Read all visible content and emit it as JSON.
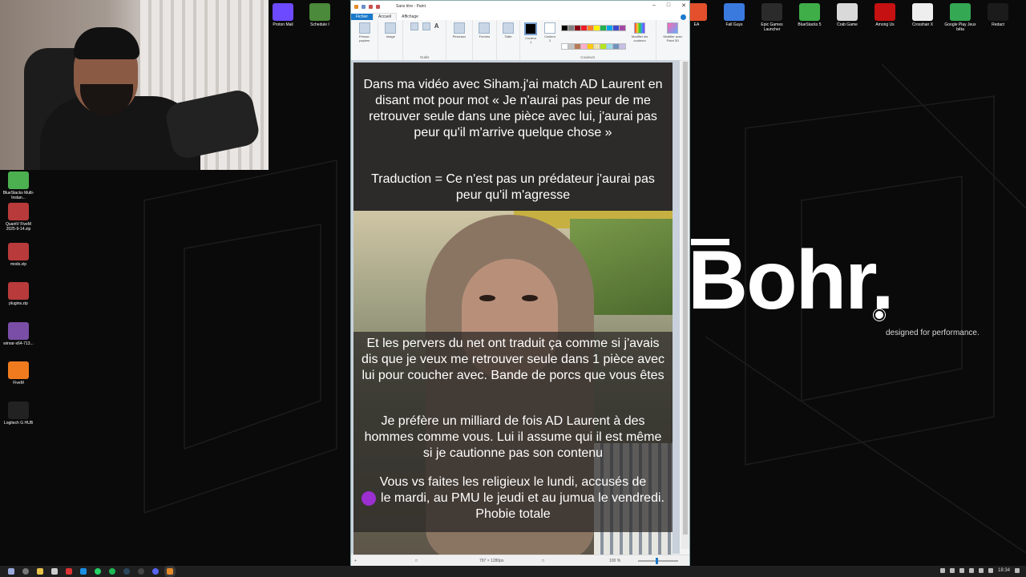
{
  "desktop": {
    "left_icons": [
      {
        "label": "BlueStacks Multi-Instan...",
        "color": "#4caf50"
      },
      {
        "label": "QuantV FiveM 2025-9-14.zip",
        "color": "#b83a3a"
      },
      {
        "label": "mods.zip",
        "color": "#b83a3a"
      },
      {
        "label": "plugins.zip",
        "color": "#b83a3a"
      },
      {
        "label": "winrar-x64-713...",
        "color": "#7a4ea6"
      },
      {
        "label": "FiveM",
        "color": "#f07b1e"
      },
      {
        "label": "Logitech G HUB",
        "color": "#222222"
      }
    ],
    "top_icons_left": [
      {
        "label": "Proton Mail",
        "color": "#6d4aff"
      },
      {
        "label": "Schedule I",
        "color": "#4a8a3a"
      }
    ],
    "top_icons_right": [
      {
        "label": "EA",
        "color": "#e4502c"
      },
      {
        "label": "Fall Guys",
        "color": "#3a7adf"
      },
      {
        "label": "Epic Games Launcher",
        "color": "#2b2b2b"
      },
      {
        "label": "BlueStacks 5",
        "color": "#3fae49"
      },
      {
        "label": "Crab Game",
        "color": "#d9d9d9"
      },
      {
        "label": "Among Us",
        "color": "#c51111"
      },
      {
        "label": "Crosshair X",
        "color": "#eeeeee"
      },
      {
        "label": "Google Play Jeux bêta",
        "color": "#34a853"
      },
      {
        "label": "Redact",
        "color": "#1b1b1b"
      }
    ],
    "wallpaper": {
      "brand": "Bohr.",
      "tagline": "designed for performance."
    }
  },
  "paint": {
    "title": "Sans titre - Paint",
    "tabs": [
      "Fichier",
      "Accueil",
      "Affichage"
    ],
    "ribbon": {
      "groups": [
        "Presse-papiers",
        "Image",
        "Outils",
        "Pinceaux",
        "Formes",
        "Taille",
        "Couleur 1",
        "Couleur 2",
        "Couleurs",
        "Modifier les couleurs",
        "Modifier avec Paint 3D"
      ],
      "group_labels": [
        "Outils",
        "Couleurs"
      ],
      "palette": [
        "#000000",
        "#7f7f7f",
        "#880015",
        "#ed1c24",
        "#ff7f27",
        "#fff200",
        "#22b14c",
        "#00a2e8",
        "#3f48cc",
        "#a349a4",
        "#ffffff",
        "#c3c3c3",
        "#b97a57",
        "#ffaec9",
        "#ffc90e",
        "#efe4b0",
        "#b5e61d",
        "#99d9ea",
        "#7092be",
        "#c8bfe7"
      ]
    },
    "canvas_text": {
      "para1": "Dans ma vidéo avec Siham.j'ai match AD Laurent en disant mot pour mot « Je n'aurai pas peur de me retrouver seule dans une pièce avec lui, j'aurai pas peur qu'il m'arrive quelque chose »",
      "para2": "Traduction = Ce n'est pas un prédateur j'aurai pas peur qu'il m'agresse",
      "para3": "Et les pervers du net ont traduit ça comme si j'avais dis que je veux me retrouver seule dans 1 pièce avec lui pour coucher avec. Bande de porcs que vous êtes",
      "para4": "Je préfère un milliard de fois AD Laurent à des hommes comme vous. Lui il assume qui il est même si je cautionne pas son contenu",
      "para5_line1": "Vous vs faites les religieux le lundi, accusés de",
      "para5_rest": "le mardi, au PMU le jeudi et au jumua le vendredi. Phobie totale"
    },
    "statusbar": {
      "dimensions": "797 × 1280px",
      "zoom": "100 %"
    }
  },
  "taskbar": {
    "time": "18:34"
  }
}
